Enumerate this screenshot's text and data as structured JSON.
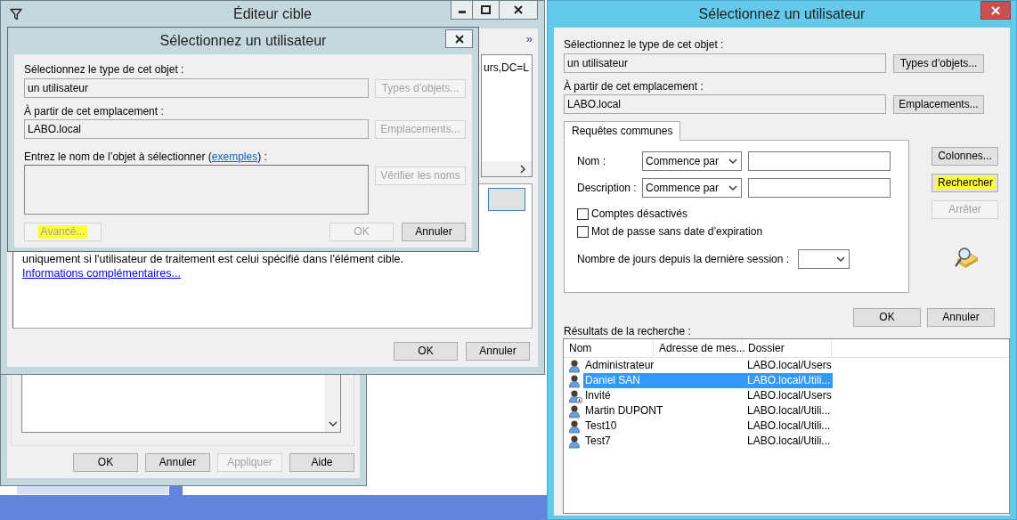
{
  "property_window": {
    "buttons": [
      {
        "label": "OK",
        "disabled": false
      },
      {
        "label": "Annuler",
        "disabled": false
      },
      {
        "label": "Appliquer",
        "disabled": true
      },
      {
        "label": "Aide",
        "disabled": false
      }
    ]
  },
  "editor_window": {
    "title": "Éditeur cible",
    "more_glyph": "»",
    "list_text": "urs,DC=L",
    "description": {
      "text": "uniquement si l'utilisateur de traitement est celui spécifié dans l'élément cible.",
      "link": "Informations complémentaires..."
    },
    "buttons": [
      {
        "label": "OK",
        "disabled": false
      },
      {
        "label": "Annuler",
        "disabled": false
      }
    ]
  },
  "back_dialog": {
    "title": "Sélectionnez un utilisateur",
    "type_label": "Sélectionnez le type de cet objet :",
    "type_value": "un utilisateur",
    "type_button": {
      "label": "Types d’objets...",
      "disabled": true
    },
    "location_label": "À partir de cet emplacement :",
    "location_value": "LABO.local",
    "location_button": {
      "label": "Emplacements...",
      "disabled": true
    },
    "name_prompt": {
      "before": "Entrez le nom de l’objet à sélectionner (",
      "link": "exemples",
      "after": ") :"
    },
    "check_button": {
      "label": "Vérifier les noms",
      "disabled": true
    },
    "buttons": [
      {
        "label": "Avancé...",
        "disabled": true,
        "highlighted": true
      },
      {
        "label": "OK",
        "disabled": true,
        "highlighted": false
      },
      {
        "label": "Annuler",
        "disabled": false,
        "highlighted": false
      }
    ]
  },
  "front_dialog": {
    "title": "Sélectionnez un utilisateur",
    "type_label": "Sélectionnez le type de cet objet :",
    "type_value": "un utilisateur",
    "type_button": {
      "label": "Types d’objets...",
      "disabled": false
    },
    "location_label": "À partir de cet emplacement :",
    "location_value": "LABO.local",
    "location_button": {
      "label": "Emplacements...",
      "disabled": false
    },
    "tabs": [
      {
        "label": "Requêtes communes",
        "selected": true
      }
    ],
    "query": {
      "fields": [
        {
          "label": "Nom :",
          "operator": "Commence par"
        },
        {
          "label": "Description :",
          "operator": "Commence par"
        }
      ],
      "checkboxes": [
        {
          "label": "Comptes désactivés",
          "checked": false
        },
        {
          "label": "Mot de passe sans date d’expiration",
          "checked": false
        }
      ],
      "days_label": "Nombre de jours depuis la dernière session :"
    },
    "side_buttons": [
      {
        "label": "Colonnes...",
        "disabled": false,
        "highlighted": false
      },
      {
        "label": "Rechercher",
        "disabled": false,
        "highlighted": true
      },
      {
        "label": "Arrêter",
        "disabled": true,
        "highlighted": false
      }
    ],
    "buttons": [
      {
        "label": "OK",
        "disabled": false
      },
      {
        "label": "Annuler",
        "disabled": false
      }
    ],
    "results_label": "Résultats de la recherche :",
    "results": {
      "columns": [
        "Nom",
        "Adresse de mes...",
        "Dossier"
      ],
      "rows": [
        {
          "name": "Administrateur",
          "folder": "LABO.local/Users",
          "selected": false,
          "disabled": false
        },
        {
          "name": "Daniel SAN",
          "folder": "LABO.local/Utili...",
          "selected": true,
          "disabled": false
        },
        {
          "name": "Invité",
          "folder": "LABO.local/Users",
          "selected": false,
          "disabled": true
        },
        {
          "name": "Martin DUPONT",
          "folder": "LABO.local/Utili...",
          "selected": false,
          "disabled": false
        },
        {
          "name": "Test10",
          "folder": "LABO.local/Utili...",
          "selected": false,
          "disabled": false
        },
        {
          "name": "Test7",
          "folder": "LABO.local/Utili...",
          "selected": false,
          "disabled": false
        }
      ]
    }
  }
}
